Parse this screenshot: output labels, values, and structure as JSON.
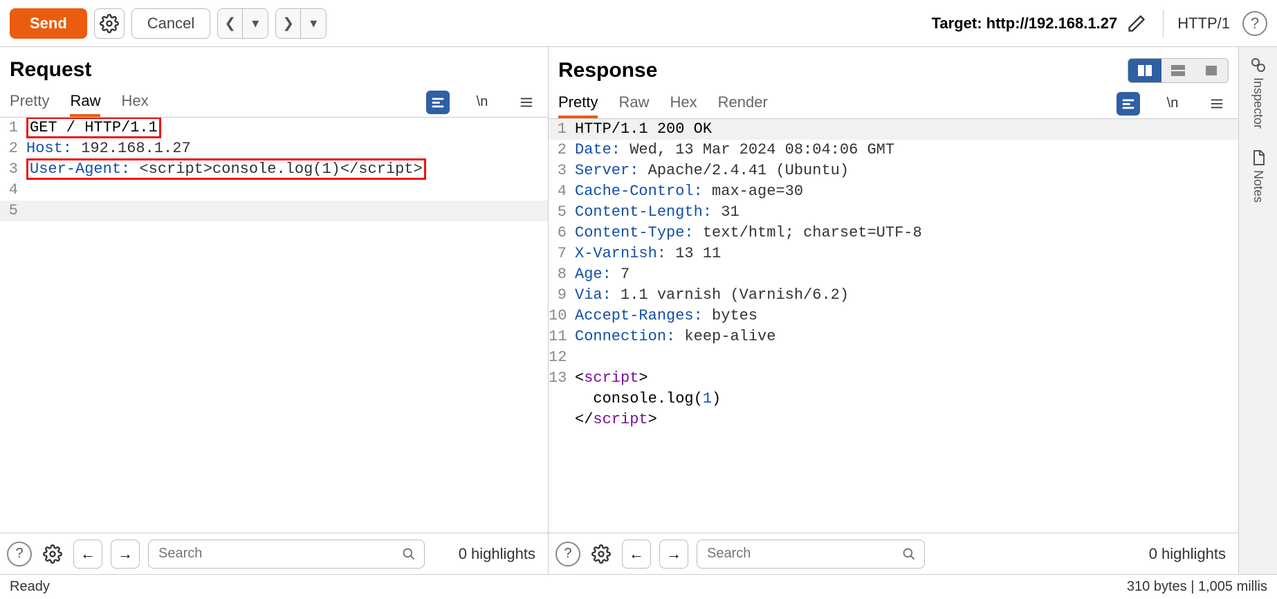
{
  "toolbar": {
    "send_label": "Send",
    "cancel_label": "Cancel",
    "target_label": "Target: http://192.168.1.27",
    "protocol_label": "HTTP/1"
  },
  "request": {
    "title": "Request",
    "tabs": {
      "pretty": "Pretty",
      "raw": "Raw",
      "hex": "Hex"
    },
    "active_tab": "Raw",
    "lines": {
      "l1_method": "GET / HTTP/1.1",
      "l2_key": "Host:",
      "l2_val": " 192.168.1.27",
      "l3_key": "User-Agent:",
      "l3_val": " <script>console.log(1)</script>"
    },
    "search_placeholder": "Search",
    "highlights_text": "0 highlights"
  },
  "response": {
    "title": "Response",
    "tabs": {
      "pretty": "Pretty",
      "raw": "Raw",
      "hex": "Hex",
      "render": "Render"
    },
    "active_tab": "Pretty",
    "lines": {
      "l1": "HTTP/1.1 200 OK",
      "l2_key": "Date:",
      "l2_val": " Wed, 13 Mar 2024 08:04:06 GMT",
      "l3_key": "Server:",
      "l3_val": " Apache/2.4.41 (Ubuntu)",
      "l4_key": "Cache-Control:",
      "l4_val": " max-age=30",
      "l5_key": "Content-Length:",
      "l5_val": " 31",
      "l6_key": "Content-Type:",
      "l6_val": " text/html; charset=UTF-8",
      "l7_key": "X-Varnish:",
      "l7_val": " 13 11",
      "l8_key": "Age:",
      "l8_val": " 7",
      "l9_key": "Via:",
      "l9_val": " 1.1 varnish (Varnish/6.2)",
      "l10_key": "Accept-Ranges:",
      "l10_val": " bytes",
      "l11_key": "Connection:",
      "l11_val": " keep-alive",
      "l13_open_lt": "<",
      "l13_open_tag": "script",
      "l13_open_gt": ">",
      "l14_pre": "  console.log(",
      "l14_num": "1",
      "l14_post": ")",
      "l15_open": "</",
      "l15_tag": "script",
      "l15_close": ">"
    },
    "search_placeholder": "Search",
    "highlights_text": "0 highlights"
  },
  "side": {
    "inspector": "Inspector",
    "notes": "Notes"
  },
  "status": {
    "ready": "Ready",
    "bytes_time": "310 bytes | 1,005 millis"
  }
}
